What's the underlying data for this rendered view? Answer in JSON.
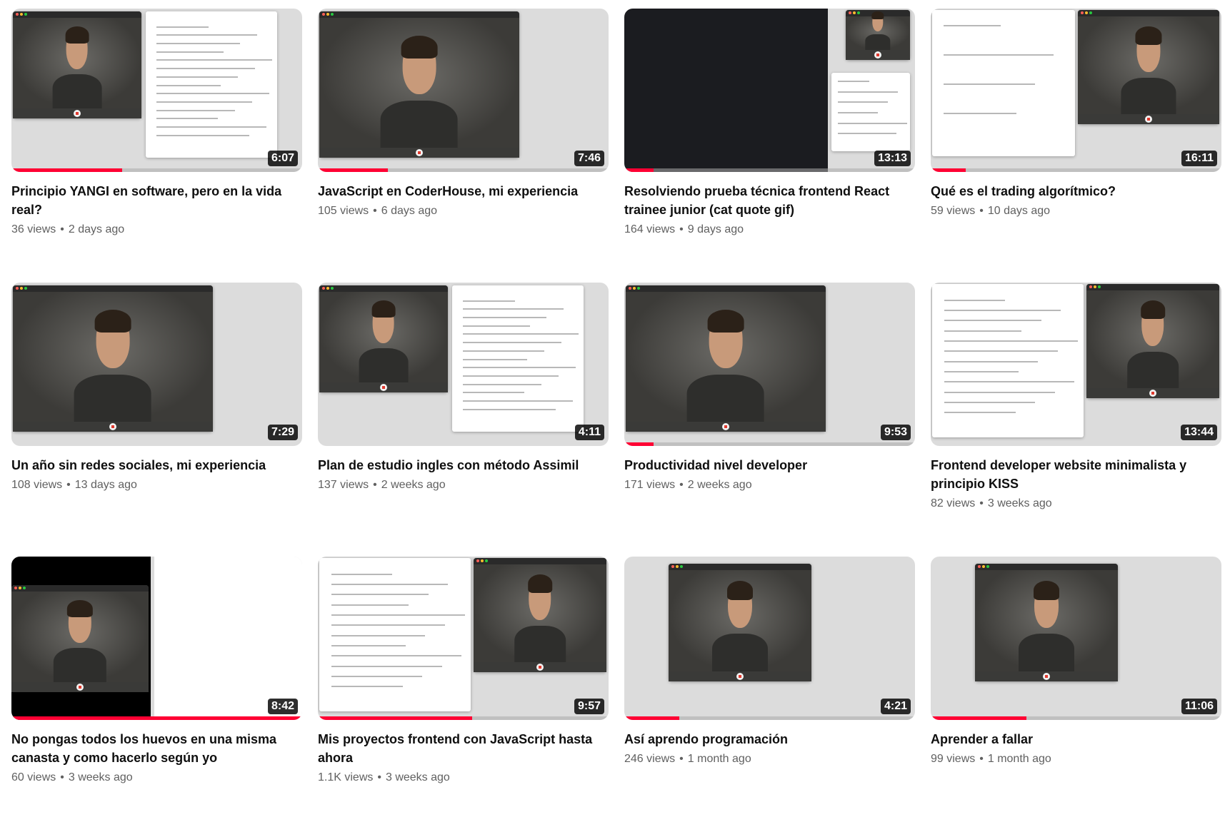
{
  "videos": [
    {
      "title": "Principio YANGI en software, pero en la vida real?",
      "views": "36 views",
      "age": "2 days ago",
      "duration": "6:07",
      "progress": 0.38,
      "thumb": "split-doc"
    },
    {
      "title": "JavaScript en CoderHouse, mi experiencia",
      "views": "105 views",
      "age": "6 days ago",
      "duration": "7:46",
      "progress": 0.24,
      "thumb": "single"
    },
    {
      "title": "Resolviendo prueba técnica frontend React trainee junior (cat quote gif)",
      "views": "164 views",
      "age": "9 days ago",
      "duration": "13:13",
      "progress": 0.1,
      "thumb": "code"
    },
    {
      "title": "Qué es el trading algorítmico?",
      "views": "59 views",
      "age": "10 days ago",
      "duration": "16:11",
      "progress": 0.12,
      "thumb": "chart"
    },
    {
      "title": "Un año sin redes sociales, mi experiencia",
      "views": "108 views",
      "age": "13 days ago",
      "duration": "7:29",
      "progress": 0.0,
      "thumb": "single"
    },
    {
      "title": "Plan de estudio ingles con método Assimil",
      "views": "137 views",
      "age": "2 weeks ago",
      "duration": "4:11",
      "progress": 0.0,
      "thumb": "split-doc"
    },
    {
      "title": "Productividad nivel developer",
      "views": "171 views",
      "age": "2 weeks ago",
      "duration": "9:53",
      "progress": 0.1,
      "thumb": "single"
    },
    {
      "title": "Frontend developer website minimalista y principio KISS",
      "views": "82 views",
      "age": "3 weeks ago",
      "duration": "13:44",
      "progress": 0.0,
      "thumb": "doc-left"
    },
    {
      "title": "No pongas todos los huevos en una misma canasta y como hacerlo según yo",
      "views": "60 views",
      "age": "3 weeks ago",
      "duration": "8:42",
      "progress": 1.0,
      "thumb": "drawing"
    },
    {
      "title": "Mis proyectos frontend con JavaScript hasta ahora",
      "views": "1.1K views",
      "age": "3 weeks ago",
      "duration": "9:57",
      "progress": 0.53,
      "thumb": "doc-left"
    },
    {
      "title": "Así aprendo programación",
      "views": "246 views",
      "age": "1 month ago",
      "duration": "4:21",
      "progress": 0.19,
      "thumb": "centered"
    },
    {
      "title": "Aprender a fallar",
      "views": "99 views",
      "age": "1 month ago",
      "duration": "11:06",
      "progress": 0.33,
      "thumb": "centered"
    }
  ]
}
